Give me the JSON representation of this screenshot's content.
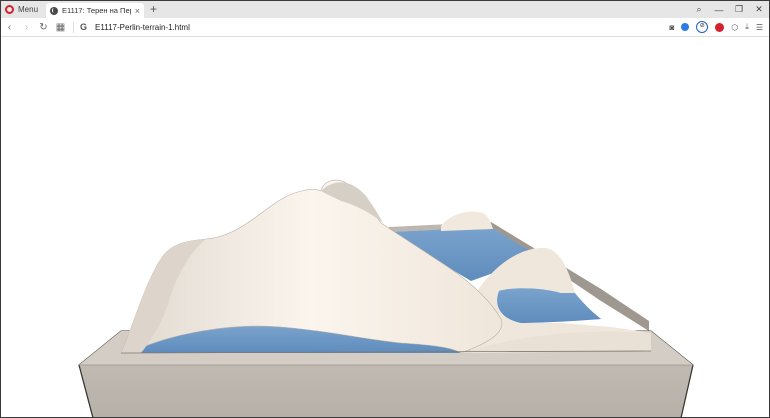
{
  "browser": {
    "menu_label": "Menu",
    "tab": {
      "title": "E1117: Терен на Перлин 1",
      "close_icon": "close-icon"
    },
    "new_tab_icon": "plus-icon",
    "url": "E1117-Perlin-terrain-1.html",
    "window_controls": [
      "search-icon",
      "minimize-icon",
      "restore-icon",
      "close-icon"
    ],
    "extension_icons": [
      "camera-icon",
      "shield-icon",
      "vpn-icon",
      "adblock-icon",
      "cube-icon",
      "download-icon",
      "settings-icon"
    ]
  },
  "scene": {
    "colors": {
      "terrain": "#f3ebe1",
      "water": "#6c98c6",
      "box_side": "#b9b3ac",
      "box_rim": "#d3ccc4"
    }
  }
}
